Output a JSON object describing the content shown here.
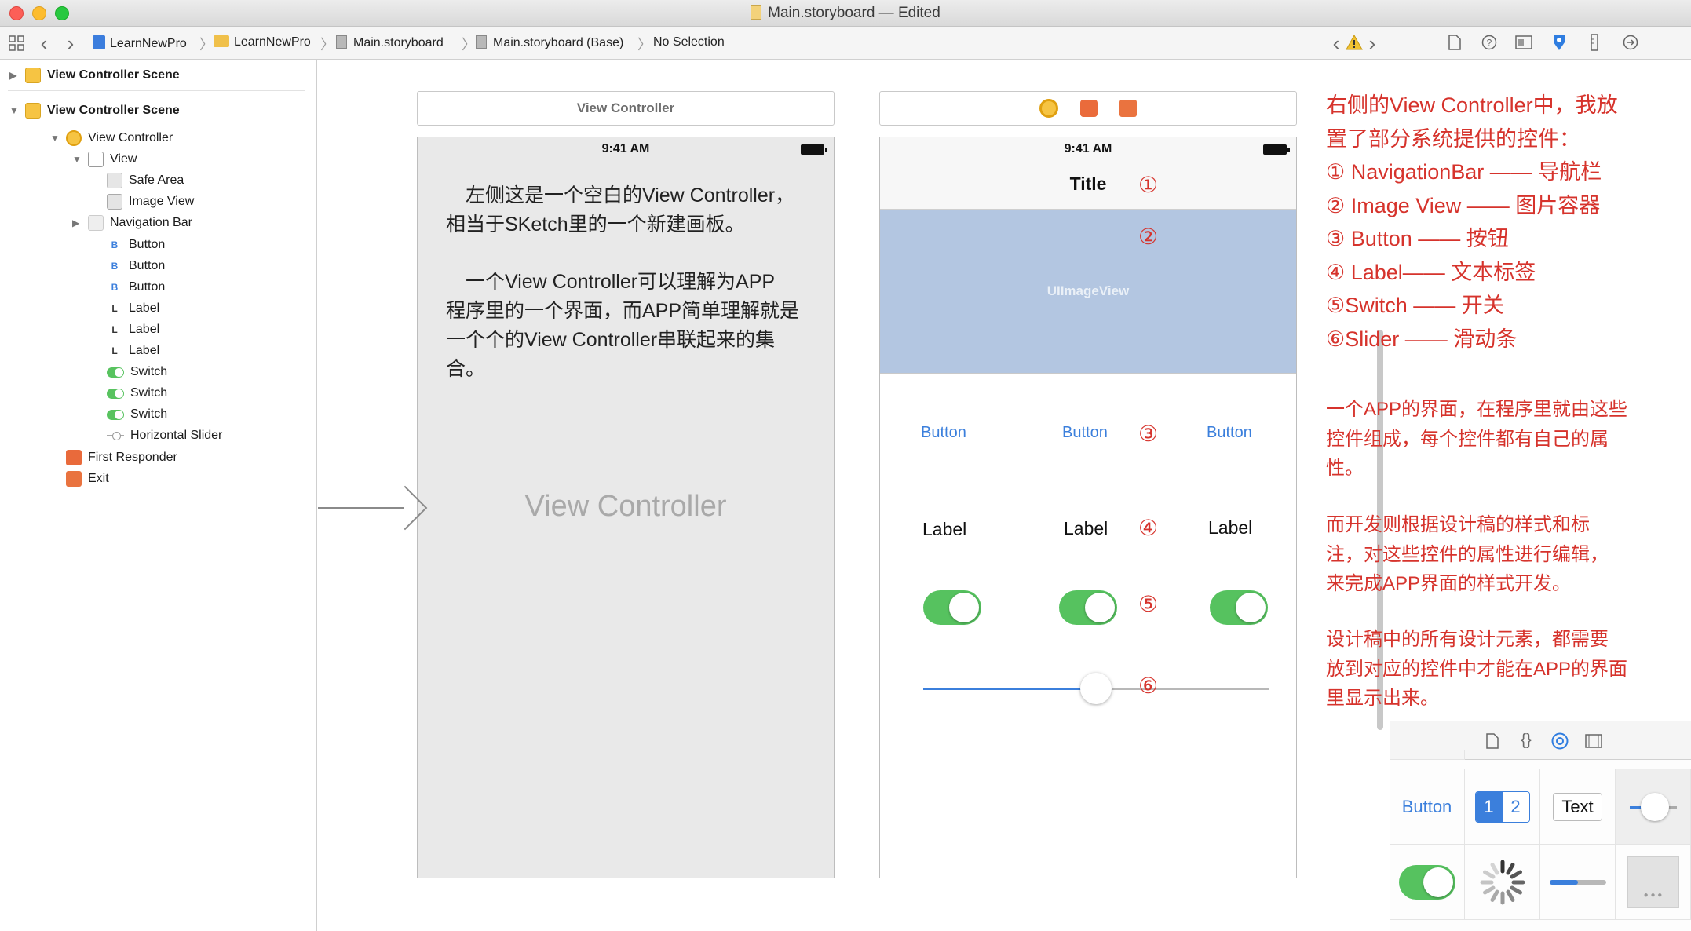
{
  "window": {
    "title": "Main.storyboard — Edited"
  },
  "jumpbar": {
    "crumbs": [
      "LearnNewPro",
      "LearnNewPro",
      "Main.storyboard",
      "Main.storyboard (Base)",
      "No Selection"
    ]
  },
  "navigator": {
    "scenes": [
      {
        "label": "View Controller Scene",
        "expanded": false
      },
      {
        "label": "View Controller Scene",
        "expanded": true
      }
    ],
    "items": [
      {
        "label": "View Controller",
        "icon": "view-controller-icon"
      },
      {
        "label": "View",
        "icon": "view-icon"
      },
      {
        "label": "Safe Area",
        "icon": "safe-area-icon"
      },
      {
        "label": "Image View",
        "icon": "image-view-icon"
      },
      {
        "label": "Navigation Bar",
        "icon": "navigation-bar-icon"
      },
      {
        "label": "Button",
        "icon": "button-icon",
        "glyph": "B"
      },
      {
        "label": "Button",
        "icon": "button-icon",
        "glyph": "B"
      },
      {
        "label": "Button",
        "icon": "button-icon",
        "glyph": "B"
      },
      {
        "label": "Label",
        "icon": "label-icon",
        "glyph": "L"
      },
      {
        "label": "Label",
        "icon": "label-icon",
        "glyph": "L"
      },
      {
        "label": "Label",
        "icon": "label-icon",
        "glyph": "L"
      },
      {
        "label": "Switch",
        "icon": "switch-icon"
      },
      {
        "label": "Switch",
        "icon": "switch-icon"
      },
      {
        "label": "Switch",
        "icon": "switch-icon"
      },
      {
        "label": "Horizontal Slider",
        "icon": "slider-icon"
      },
      {
        "label": "First Responder",
        "icon": "first-responder-icon"
      },
      {
        "label": "Exit",
        "icon": "exit-icon"
      }
    ]
  },
  "left_scene": {
    "header": "View Controller",
    "time": "9:41 AM",
    "para1": "左侧这是一个空白的View Controller，相当于SKetch里的一个新建画板。",
    "para1_lines": [
      "　左侧这是一个空白的View Controller，",
      "相当于SKetch里的一个新建画板。"
    ],
    "para2_lines": [
      "　一个View Controller可以理解为APP",
      "程序里的一个界面，而APP简单理解就是",
      "一个个的View Controller串联起来的集",
      "合。"
    ],
    "watermark": "View Controller"
  },
  "right_scene": {
    "time": "9:41 AM",
    "nav_title": "Title",
    "image_view_label": "UIImageView",
    "buttons": [
      "Button",
      "Button",
      "Button"
    ],
    "labels": [
      "Label",
      "Label",
      "Label"
    ],
    "markers": [
      "①",
      "②",
      "③",
      "④",
      "⑤",
      "⑥"
    ],
    "slider_value": 0.5
  },
  "annotation": {
    "intro": [
      "右侧的View Controller中，我放",
      "置了部分系统提供的控件："
    ],
    "list": [
      "① NavigationBar —— 导航栏",
      "② Image View —— 图片容器",
      "③ Button —— 按钮",
      "④ Label—— 文本标签",
      "⑤Switch —— 开关",
      "⑥Slider —— 滑动条"
    ],
    "p1": [
      "一个APP的界面，在程序里就由这些",
      "控件组成，每个控件都有自己的属",
      "性。"
    ],
    "p2": [
      "而开发则根据设计稿的样式和标",
      "注，对这些控件的属性进行编辑，",
      "来完成APP界面的样式开发。"
    ],
    "p3": [
      "设计稿中的所有设计元素，都需要",
      "放到对应的控件中才能在APP的界面",
      "里显示出来。"
    ]
  },
  "library": {
    "button_label": "Button",
    "segment_labels": [
      "1",
      "2"
    ],
    "textfield_label": "Text"
  },
  "colors": {
    "annotation_red": "#d6332c",
    "ios_blue": "#3b7fdc",
    "switch_green": "#56c25f",
    "image_view_fill": "#b3c6e1"
  }
}
